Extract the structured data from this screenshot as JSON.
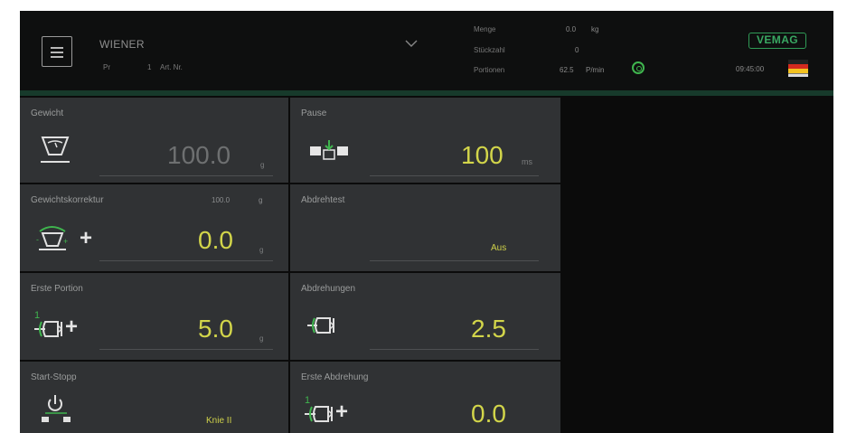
{
  "header": {
    "product_name": "WIENER",
    "prog_label": "Pr",
    "prog_value": "1",
    "article_label": "Art. Nr.",
    "stats": [
      {
        "label": "Menge",
        "value": "0.0",
        "unit": "kg"
      },
      {
        "label": "Stückzahl",
        "value": "0",
        "unit": ""
      },
      {
        "label": "Portionen",
        "value": "62.5",
        "unit": "P/min"
      }
    ],
    "brand": "VEMAG",
    "time": "09:45:00",
    "icons": [
      "menu-icon",
      "chevron-down-icon",
      "spool-icon",
      "flag-keyboard-icon"
    ]
  },
  "tiles": {
    "weight": {
      "label": "Gewicht",
      "value": "100.0",
      "unit": "g"
    },
    "pause": {
      "label": "Pause",
      "value": "100",
      "unit": "ms"
    },
    "weight_correction": {
      "label": "Gewichtskorrektur",
      "ref_value": "100.0",
      "ref_unit": "g",
      "value": "0.0",
      "unit": "g"
    },
    "twist_test": {
      "label": "Abdrehtest",
      "value": "Aus"
    },
    "first_portion": {
      "label": "Erste Portion",
      "value": "5.0",
      "unit": "g"
    },
    "twists": {
      "label": "Abdrehungen",
      "value": "2.5"
    },
    "start_stop": {
      "label": "Start-Stopp",
      "value": "Knie II"
    },
    "first_twist": {
      "label": "Erste Abdrehung",
      "value": "0.0"
    }
  },
  "colors": {
    "accent_value": "#d2d54a",
    "brand_green": "#2f9b56",
    "tile_bg": "#303234",
    "screen_bg": "#0b0b0b"
  }
}
